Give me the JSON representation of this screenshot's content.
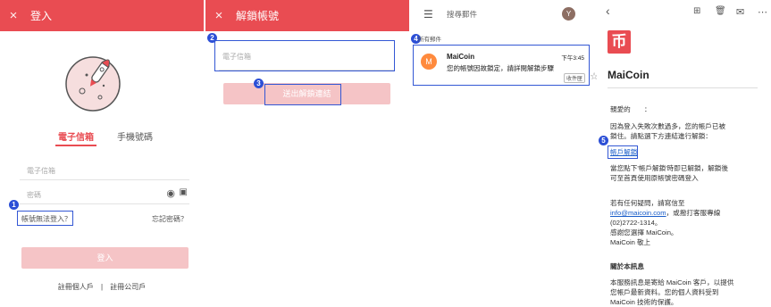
{
  "panel1": {
    "close": "×",
    "title": "登入",
    "tab_email": "電子信箱",
    "tab_phone": "手機號碼",
    "email_placeholder": "電子信箱",
    "password_placeholder": "密碼",
    "cant_login": "帳號無法登入？",
    "forgot": "忘記密碼？",
    "login_button": "登入",
    "register_personal": "註冊個人戶",
    "divider": "|",
    "register_company": "註冊公司戶",
    "badge": "1"
  },
  "panel2": {
    "close": "×",
    "title": "解鎖帳號",
    "email_placeholder": "電子信箱",
    "send_button": "送出解鎖連結",
    "badge_input": "2",
    "badge_button": "3"
  },
  "panel3": {
    "search_placeholder": "搜尋郵件",
    "avatar_letter": "Y",
    "section": "所有郵件",
    "badge": "4",
    "mail": {
      "avatar_letter": "M",
      "sender": "MaiCoin",
      "time": "下午3:45",
      "subject": "您的帳號因故鎖定，請詳閱解鎖步驟",
      "label": "收件匣"
    }
  },
  "panel4": {
    "logo_glyph": "币",
    "brand": "MaiCoin",
    "greeting": "親愛的　　：",
    "para1_line1": "因為登入失敗次數過多，您的帳戶已被",
    "para1_line2": "鎖住。請點選下方連結進行解鎖：",
    "unlock_link": "帳戶解鎖",
    "badge": "5",
    "para2_line1": "當您點下'帳戶解鎖'時即已解鎖，解鎖後",
    "para2_line2": "可至首頁使用原帳號密碼登入",
    "contact_line1": "若有任何疑問，請寫信至",
    "contact_email": "info@maicoin.com",
    "contact_line1b": "，或撥打客服專線",
    "contact_phone": "(02)2722-1314。",
    "thanks": "感謝您選擇 MaiCoin。",
    "signoff": "MaiCoin 敬上",
    "about_title": "關於本訊息",
    "about_line1": "本服務訊息是寄給 MaiCoin 客戶，以提供",
    "about_line2": "您帳戶最新資料。您的個人資料受到",
    "about_line3": "MaiCoin 技術的保護。"
  },
  "colors": {
    "brand_red": "#e94c52",
    "button_disabled": "#f5c4c6",
    "highlight_blue": "#3357d4",
    "gmail_avatar": "#ff8a3d",
    "link_blue": "#1a5dc9"
  }
}
